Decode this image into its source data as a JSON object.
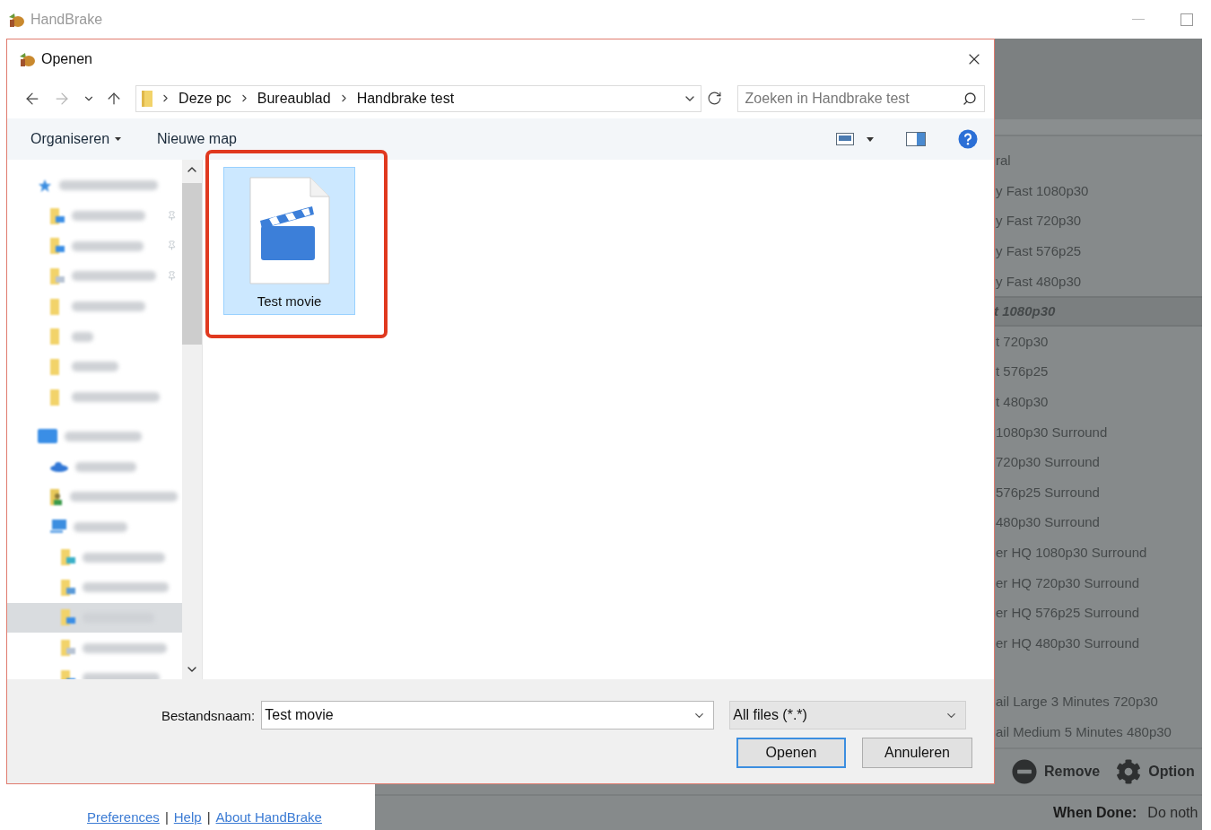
{
  "app": {
    "title": "HandBrake"
  },
  "dialog": {
    "title": "Openen",
    "breadcrumbs": [
      "Deze pc",
      "Bureaublad",
      "Handbrake test"
    ],
    "search": {
      "placeholder": "Zoeken in Handbrake test"
    },
    "toolbar": {
      "organize": "Organiseren",
      "new_folder": "Nieuwe map"
    },
    "nav_items": [
      {
        "kind": "star",
        "selected": false,
        "pinned": false,
        "children": [
          {
            "kind": "desktops",
            "selected": false,
            "pinned": true
          },
          {
            "kind": "downloads",
            "selected": false,
            "pinned": true
          },
          {
            "kind": "documents",
            "selected": false,
            "pinned": true
          },
          {
            "kind": "folder",
            "selected": false,
            "pinned": false
          },
          {
            "kind": "folder",
            "selected": false,
            "pinned": false
          },
          {
            "kind": "folder",
            "selected": false,
            "pinned": false
          },
          {
            "kind": "folder",
            "selected": false,
            "pinned": false
          }
        ]
      },
      {
        "kind": "desktop",
        "selected": false,
        "pinned": false,
        "children": [
          {
            "kind": "cloud",
            "selected": false,
            "pinned": false
          },
          {
            "kind": "user",
            "selected": false,
            "pinned": false
          },
          {
            "kind": "pc",
            "selected": false,
            "pinned": false,
            "children": [
              {
                "kind": "objects",
                "selected": false,
                "pinned": false
              },
              {
                "kind": "pictures",
                "selected": false,
                "pinned": false
              },
              {
                "kind": "desktops",
                "selected": true,
                "pinned": false
              },
              {
                "kind": "documents",
                "selected": false,
                "pinned": false
              },
              {
                "kind": "downloads",
                "selected": false,
                "pinned": false
              }
            ]
          }
        ]
      }
    ],
    "files": [
      {
        "name": "Test movie",
        "selected": true,
        "highlighted": true
      }
    ],
    "filename": {
      "label": "Bestandsnaam:",
      "value": "Test movie"
    },
    "filter": {
      "value": "All files (*.*)"
    },
    "buttons": [
      {
        "label": "Openen",
        "default": true
      },
      {
        "label": "Annuleren",
        "default": false
      }
    ]
  },
  "presets": [
    {
      "label": "ral",
      "kind": "header",
      "selected": false
    },
    {
      "label": "y Fast 1080p30",
      "kind": "preset",
      "selected": false
    },
    {
      "label": "y Fast 720p30",
      "kind": "preset",
      "selected": false
    },
    {
      "label": "y Fast 576p25",
      "kind": "preset",
      "selected": false
    },
    {
      "label": "y Fast 480p30",
      "kind": "preset",
      "selected": false
    },
    {
      "label": "t 1080p30",
      "kind": "preset",
      "selected": true
    },
    {
      "label": "t 720p30",
      "kind": "preset",
      "selected": false
    },
    {
      "label": "t 576p25",
      "kind": "preset",
      "selected": false
    },
    {
      "label": "t 480p30",
      "kind": "preset",
      "selected": false
    },
    {
      "label": "1080p30 Surround",
      "kind": "preset",
      "selected": false
    },
    {
      "label": "720p30 Surround",
      "kind": "preset",
      "selected": false
    },
    {
      "label": "576p25 Surround",
      "kind": "preset",
      "selected": false
    },
    {
      "label": "480p30 Surround",
      "kind": "preset",
      "selected": false
    },
    {
      "label": "er HQ 1080p30 Surround",
      "kind": "preset",
      "selected": false
    },
    {
      "label": "er HQ 720p30 Surround",
      "kind": "preset",
      "selected": false
    },
    {
      "label": "er HQ 576p25 Surround",
      "kind": "preset",
      "selected": false
    },
    {
      "label": "er HQ 480p30 Surround",
      "kind": "preset",
      "selected": false
    },
    {
      "kind": "gap",
      "selected": false
    },
    {
      "label": "ail Large 3 Minutes 720p30",
      "kind": "preset",
      "selected": false
    },
    {
      "label": "ail Medium 5 Minutes 480p30",
      "kind": "preset",
      "selected": false
    }
  ],
  "actions": [
    {
      "kind": "remove",
      "label": "Remove"
    },
    {
      "kind": "options",
      "label": "Option"
    }
  ],
  "when_done": {
    "label": "When Done:",
    "value": "Do noth"
  },
  "footer_links": {
    "links": [
      "Preferences",
      "Help",
      "About HandBrake"
    ],
    "separator": "|"
  }
}
